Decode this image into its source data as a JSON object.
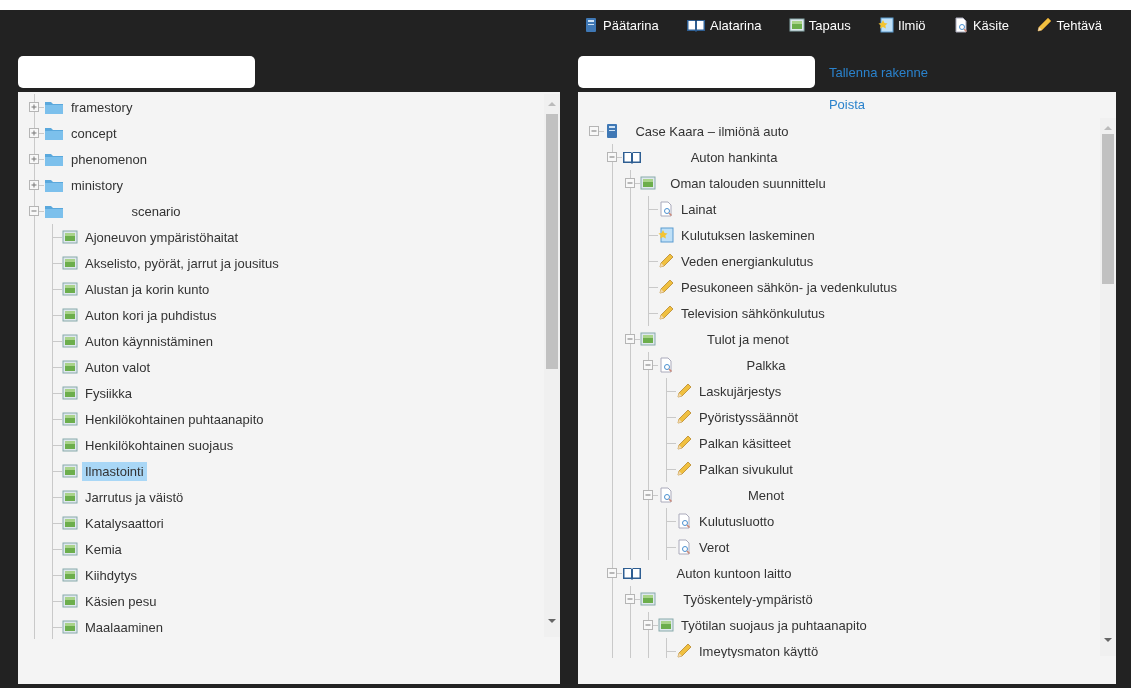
{
  "legend": [
    {
      "kind": "main-story",
      "label": "Päätarina"
    },
    {
      "kind": "sub-story",
      "label": "Alatarina"
    },
    {
      "kind": "case",
      "label": "Tapaus"
    },
    {
      "kind": "phenomenon",
      "label": "Ilmiö"
    },
    {
      "kind": "concept",
      "label": "Käsite"
    },
    {
      "kind": "task",
      "label": "Tehtävä"
    }
  ],
  "structure_actions": {
    "save_link": "Tallenna rakenne",
    "delete_link": "Poista"
  },
  "library_tree": [
    {
      "kind": "folder",
      "label": "framestory",
      "expanded": false,
      "selected": false
    },
    {
      "kind": "folder",
      "label": "concept",
      "expanded": false,
      "selected": false
    },
    {
      "kind": "folder",
      "label": "phenomenon",
      "expanded": false,
      "selected": false
    },
    {
      "kind": "folder",
      "label": "ministory",
      "expanded": false,
      "selected": false
    },
    {
      "kind": "folder",
      "label": "scenario",
      "expanded": true,
      "selected": false,
      "children": [
        {
          "kind": "case",
          "label": "Ajoneuvon ympäristöhaitat",
          "selected": false
        },
        {
          "kind": "case",
          "label": "Akselisto, pyörät, jarrut ja jousitus",
          "selected": false
        },
        {
          "kind": "case",
          "label": "Alustan ja korin kunto",
          "selected": false
        },
        {
          "kind": "case",
          "label": "Auton kori ja puhdistus",
          "selected": false
        },
        {
          "kind": "case",
          "label": "Auton käynnistäminen",
          "selected": false
        },
        {
          "kind": "case",
          "label": "Auton valot",
          "selected": false
        },
        {
          "kind": "case",
          "label": "Fysiikka",
          "selected": false
        },
        {
          "kind": "case",
          "label": "Henkilökohtainen puhtaanapito",
          "selected": false
        },
        {
          "kind": "case",
          "label": "Henkilökohtainen suojaus",
          "selected": false
        },
        {
          "kind": "case",
          "label": "Ilmastointi",
          "selected": true
        },
        {
          "kind": "case",
          "label": "Jarrutus ja väistö",
          "selected": false
        },
        {
          "kind": "case",
          "label": "Katalysaattori",
          "selected": false
        },
        {
          "kind": "case",
          "label": "Kemia",
          "selected": false
        },
        {
          "kind": "case",
          "label": "Kiihdytys",
          "selected": false
        },
        {
          "kind": "case",
          "label": "Käsien pesu",
          "selected": false
        },
        {
          "kind": "case",
          "label": "Maalaaminen",
          "selected": false
        }
      ]
    }
  ],
  "structure_tree": [
    {
      "kind": "main-story",
      "label": "Case Kaara – ilmiönä auto",
      "expanded": true,
      "selected": false,
      "children": [
        {
          "kind": "sub-story",
          "label": "Auton hankinta",
          "expanded": true,
          "selected": false,
          "children": [
            {
              "kind": "case",
              "label": "Oman talouden suunnittelu",
              "expanded": true,
              "selected": false,
              "children": [
                {
                  "kind": "concept",
                  "label": "Lainat",
                  "selected": false
                },
                {
                  "kind": "phenomenon",
                  "label": "Kulutuksen laskeminen",
                  "selected": false
                },
                {
                  "kind": "task",
                  "label": "Veden energiankulutus",
                  "selected": false
                },
                {
                  "kind": "task",
                  "label": "Pesukoneen sähkön- ja vedenkulutus",
                  "selected": false
                },
                {
                  "kind": "task",
                  "label": "Television sähkönkulutus",
                  "selected": false
                }
              ]
            },
            {
              "kind": "case",
              "label": "Tulot ja menot",
              "expanded": true,
              "selected": false,
              "children": [
                {
                  "kind": "concept",
                  "label": "Palkka",
                  "expanded": true,
                  "selected": false,
                  "children": [
                    {
                      "kind": "task",
                      "label": "Laskujärjestys",
                      "selected": false
                    },
                    {
                      "kind": "task",
                      "label": "Pyöristyssäännöt",
                      "selected": false
                    },
                    {
                      "kind": "task",
                      "label": "Palkan käsitteet",
                      "selected": false
                    },
                    {
                      "kind": "task",
                      "label": "Palkan sivukulut",
                      "selected": false
                    }
                  ]
                },
                {
                  "kind": "concept",
                  "label": "Menot",
                  "expanded": true,
                  "selected": false,
                  "children": [
                    {
                      "kind": "concept",
                      "label": "Kulutusluotto",
                      "selected": false
                    },
                    {
                      "kind": "concept",
                      "label": "Verot",
                      "selected": false
                    }
                  ]
                }
              ]
            }
          ]
        },
        {
          "kind": "sub-story",
          "label": "Auton kuntoon laitto",
          "expanded": true,
          "selected": false,
          "children": [
            {
              "kind": "case",
              "label": "Työskentely-ympäristö",
              "expanded": true,
              "selected": false,
              "children": [
                {
                  "kind": "case",
                  "label": "Työtilan suojaus ja puhtaanapito",
                  "expanded": true,
                  "selected": false,
                  "children": [
                    {
                      "kind": "task",
                      "label": "Imeytysmaton käyttö",
                      "selected": false
                    }
                  ]
                }
              ]
            }
          ]
        }
      ]
    }
  ]
}
